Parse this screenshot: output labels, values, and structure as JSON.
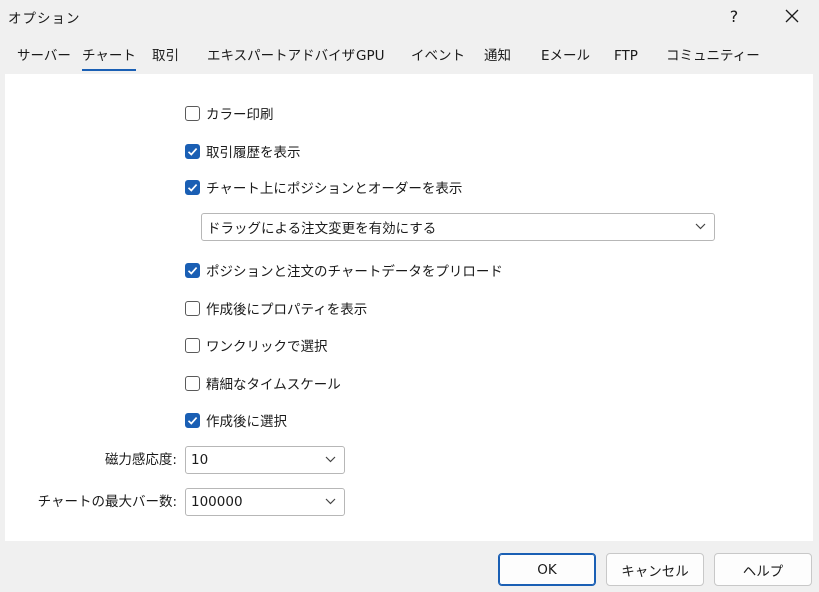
{
  "window": {
    "title": "オプション",
    "help_label": "?",
    "close_icon": "close-icon"
  },
  "tabs": [
    {
      "label": "サーバー",
      "active": false
    },
    {
      "label": "チャート",
      "active": true
    },
    {
      "label": "取引",
      "active": false
    },
    {
      "label": "エキスパートアドバイザ",
      "active": false
    },
    {
      "label": "GPU",
      "active": false
    },
    {
      "label": "イベント",
      "active": false
    },
    {
      "label": "通知",
      "active": false
    },
    {
      "label": "Eメール",
      "active": false
    },
    {
      "label": "FTP",
      "active": false
    },
    {
      "label": "コミュニティー",
      "active": false
    }
  ],
  "options": {
    "color_print": {
      "label": "カラー印刷",
      "checked": false
    },
    "show_trade_history": {
      "label": "取引履歴を表示",
      "checked": true
    },
    "show_positions_orders": {
      "label": "チャート上にポジションとオーダーを表示",
      "checked": true
    },
    "drag_mode": {
      "value": "ドラッグによる注文変更を有効にする"
    },
    "preload_chart_data": {
      "label": "ポジションと注文のチャートデータをプリロード",
      "checked": true
    },
    "show_properties_after_create": {
      "label": "作成後にプロパティを表示",
      "checked": false
    },
    "one_click_select": {
      "label": "ワンクリックで選択",
      "checked": false
    },
    "precise_time_scale": {
      "label": "精細なタイムスケール",
      "checked": false
    },
    "select_after_create": {
      "label": "作成後に選択",
      "checked": true
    }
  },
  "magnet": {
    "label": "磁力感応度:",
    "value": "10"
  },
  "max_bars": {
    "label": "チャートの最大バー数:",
    "value": "100000"
  },
  "buttons": {
    "ok": "OK",
    "cancel": "キャンセル",
    "help": "ヘルプ"
  },
  "colors": {
    "accent": "#1a5fb4",
    "panel": "#ffffff",
    "window": "#f0f0f0"
  }
}
